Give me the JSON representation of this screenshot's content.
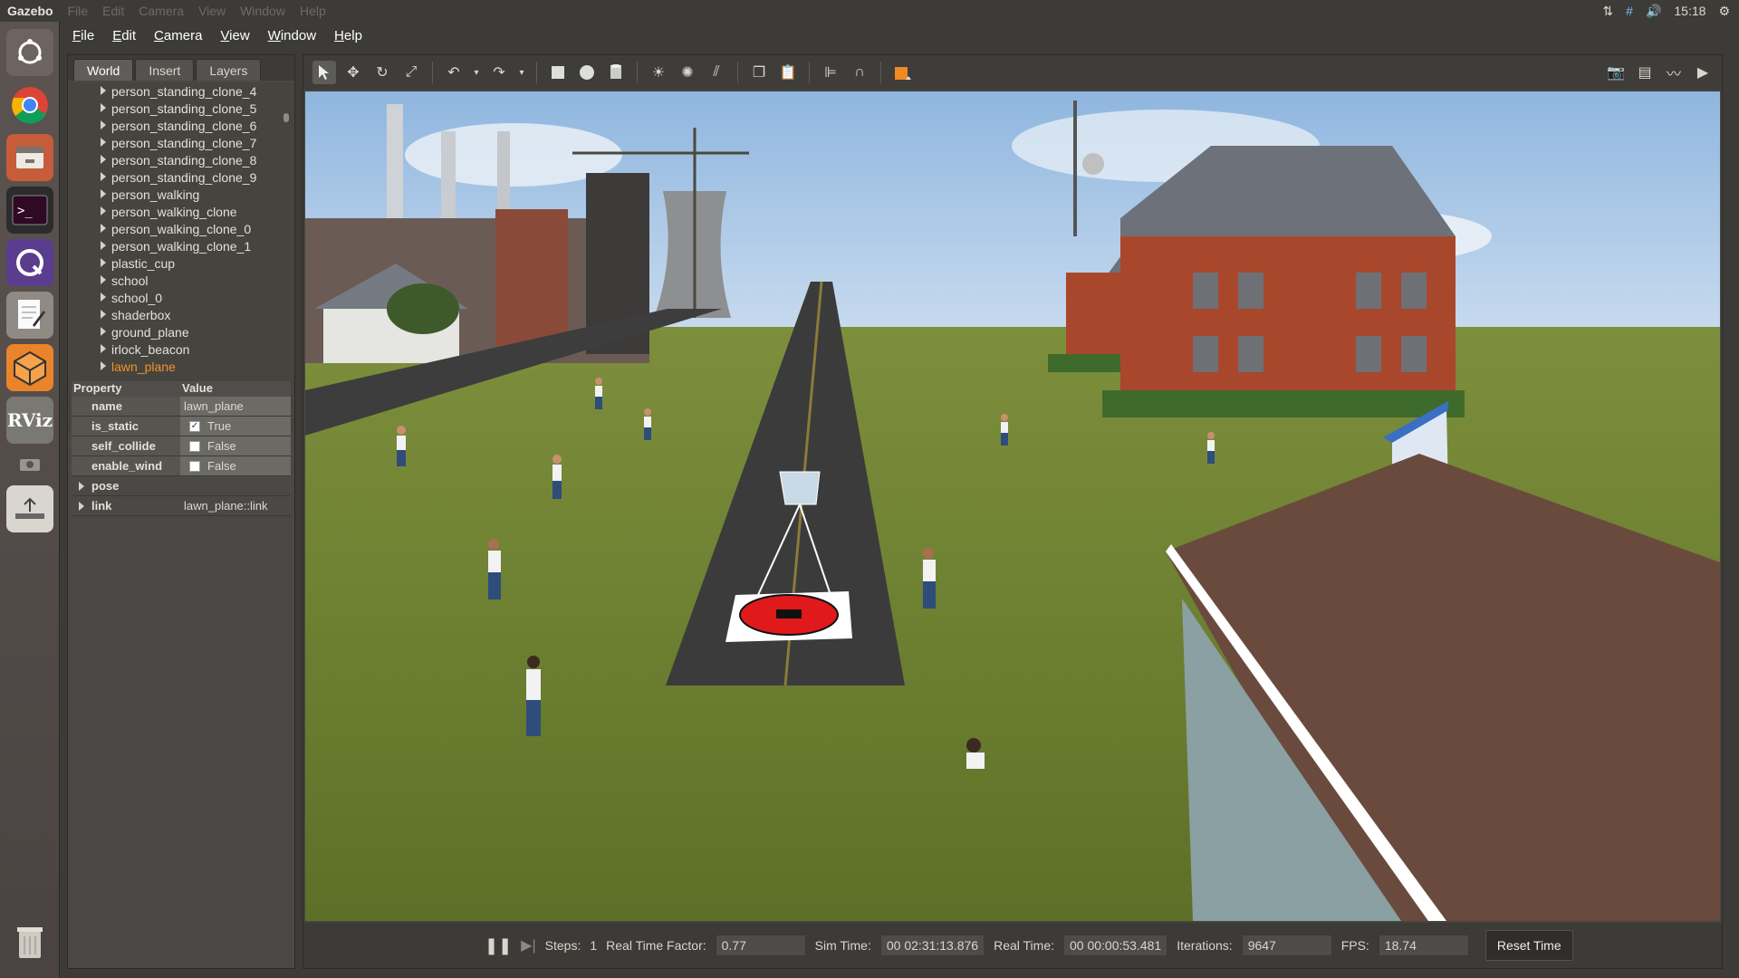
{
  "topbar": {
    "app_name": "Gazebo",
    "ghost_menu": [
      "File",
      "Edit",
      "Camera",
      "View",
      "Window",
      "Help"
    ],
    "time": "15:18"
  },
  "menubar": {
    "items": [
      "File",
      "Edit",
      "Camera",
      "View",
      "Window",
      "Help"
    ]
  },
  "left_panel": {
    "tabs": [
      "World",
      "Insert",
      "Layers"
    ],
    "active_tab": "World",
    "tree_items": [
      "person_standing_clone_4",
      "person_standing_clone_5",
      "person_standing_clone_6",
      "person_standing_clone_7",
      "person_standing_clone_8",
      "person_standing_clone_9",
      "person_walking",
      "person_walking_clone",
      "person_walking_clone_0",
      "person_walking_clone_1",
      "plastic_cup",
      "school",
      "school_0",
      "shaderbox",
      "ground_plane",
      "irlock_beacon",
      "lawn_plane"
    ],
    "selected_item": "lawn_plane",
    "properties": {
      "header_property": "Property",
      "header_value": "Value",
      "rows": [
        {
          "key": "name",
          "value": "lawn_plane",
          "checkbox": false
        },
        {
          "key": "is_static",
          "value": "True",
          "checkbox": true,
          "checked": true
        },
        {
          "key": "self_collide",
          "value": "False",
          "checkbox": true,
          "checked": false
        },
        {
          "key": "enable_wind",
          "value": "False",
          "checkbox": true,
          "checked": false
        }
      ],
      "expandable": [
        {
          "key": "pose",
          "value": ""
        },
        {
          "key": "link",
          "value": "lawn_plane::link"
        }
      ]
    }
  },
  "bottom_bar": {
    "steps_label": "Steps:",
    "steps_value": "1",
    "rtf_label": "Real Time Factor:",
    "rtf_value": "0.77",
    "sim_time_label": "Sim Time:",
    "sim_time_value": "00 02:31:13.876",
    "real_time_label": "Real Time:",
    "real_time_value": "00 00:00:53.481",
    "iterations_label": "Iterations:",
    "iterations_value": "9647",
    "fps_label": "FPS:",
    "fps_value": "18.74",
    "reset_label": "Reset Time"
  },
  "colors": {
    "selected_orange": "#f0932b",
    "sky": "#a9c8e4",
    "grass": "#6b7f2e",
    "road": "#3a3a3a",
    "brick": "#9a3a22",
    "pad_red": "#e01a1a"
  },
  "icons": {
    "launcher": [
      "ubuntu-dash-icon",
      "chrome-icon",
      "files-icon",
      "terminal-icon",
      "qgroundcontrol-icon",
      "text-editor-icon",
      "gazebo-icon",
      "rviz-icon",
      "usb-drive-icon",
      "trash-icon"
    ]
  }
}
